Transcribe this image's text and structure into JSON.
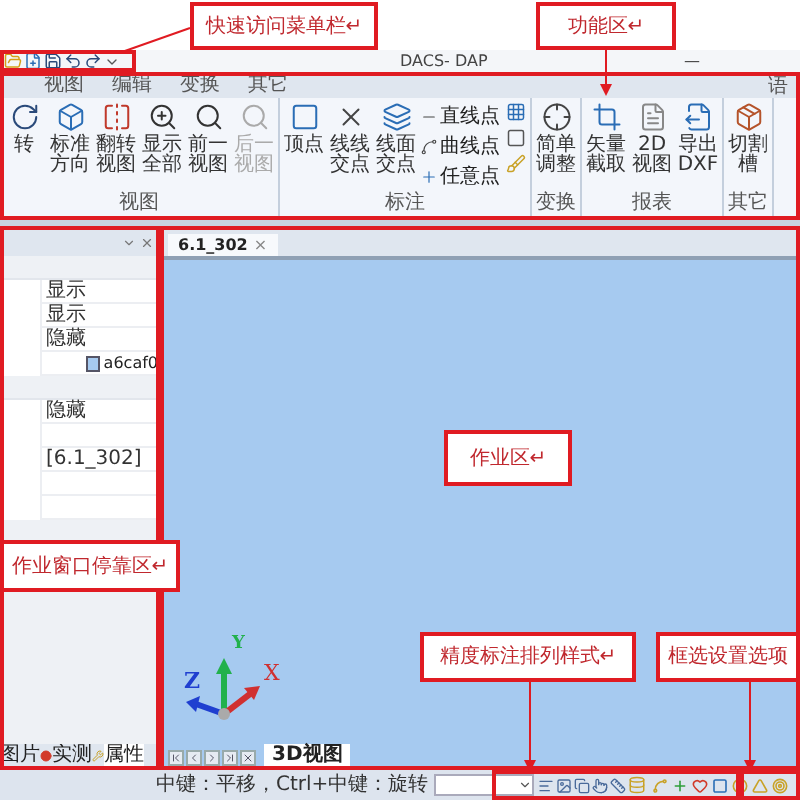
{
  "title_bar": {
    "title": "DACS- DAP",
    "minimize": "—"
  },
  "menu_tabs": [
    {
      "label": "视图",
      "selected": false
    },
    {
      "label": "编辑",
      "selected": false
    },
    {
      "label": "变换",
      "selected": false
    },
    {
      "label": "其它",
      "selected": false
    }
  ],
  "menu_right": "语",
  "ribbon": {
    "groups": [
      {
        "label": "视图",
        "buttons": [
          {
            "label": "转",
            "kind": "large",
            "disabled": false
          },
          {
            "label": "标准方向",
            "kind": "large",
            "disabled": false
          },
          {
            "label": "翻转视图",
            "kind": "large",
            "disabled": false
          },
          {
            "label": "显示全部",
            "kind": "large",
            "disabled": false
          },
          {
            "label": "前一视图",
            "kind": "large",
            "disabled": false
          },
          {
            "label": "后一视图",
            "kind": "large",
            "disabled": true
          }
        ]
      },
      {
        "label": "标注",
        "buttons": [
          {
            "label": "顶点",
            "kind": "large"
          },
          {
            "label": "线线交点",
            "kind": "large"
          },
          {
            "label": "线面交点",
            "kind": "large"
          },
          {
            "label": "直线点",
            "kind": "small"
          },
          {
            "label": "曲线点",
            "kind": "small"
          },
          {
            "label": "任意点",
            "kind": "small"
          },
          {
            "kind": "icon"
          },
          {
            "kind": "icon"
          },
          {
            "kind": "icon"
          }
        ]
      },
      {
        "label": "变换",
        "buttons": [
          {
            "label": "简单调整",
            "kind": "large"
          }
        ]
      },
      {
        "label": "报表",
        "buttons": [
          {
            "label": "矢量截取",
            "kind": "large"
          },
          {
            "label": "2D视图",
            "kind": "large"
          },
          {
            "label": "导出DXF",
            "kind": "large"
          }
        ]
      },
      {
        "label": "其它",
        "buttons": [
          {
            "label": "切割槽",
            "kind": "large"
          }
        ]
      }
    ]
  },
  "left_panel": {
    "rows": [
      {
        "kind": "section"
      },
      {
        "kind": "value",
        "value": "显示"
      },
      {
        "kind": "value",
        "value": "显示"
      },
      {
        "kind": "value",
        "value": "隐藏"
      },
      {
        "kind": "color",
        "value": "a6caf0",
        "color": "#a6caf0"
      },
      {
        "kind": "section"
      },
      {
        "kind": "value",
        "value": "隐藏"
      },
      {
        "kind": "empty"
      },
      {
        "kind": "value",
        "value": "[6.1_302]"
      },
      {
        "kind": "empty"
      },
      {
        "kind": "empty"
      }
    ],
    "tabs": [
      {
        "label": "图片",
        "selected": false
      },
      {
        "label": "实测",
        "selected": false
      },
      {
        "label": "属性",
        "selected": true
      }
    ]
  },
  "document_tab": {
    "label": "6.1_302",
    "close": "×"
  },
  "axes": {
    "x": "X",
    "y": "Y",
    "z": "Z"
  },
  "view_tab": {
    "label": "3D视图",
    "selected": true
  },
  "status_bar": {
    "hint": "中键：平移，Ctrl+中键：旋转"
  },
  "callouts": [
    {
      "text": "快速访问菜单栏↵"
    },
    {
      "text": "功能区↵"
    },
    {
      "text": "作业区↵"
    },
    {
      "text": "作业窗口停靠区↵"
    },
    {
      "text": "精度标注排列样式↵"
    },
    {
      "text": "框选设置选项"
    }
  ]
}
